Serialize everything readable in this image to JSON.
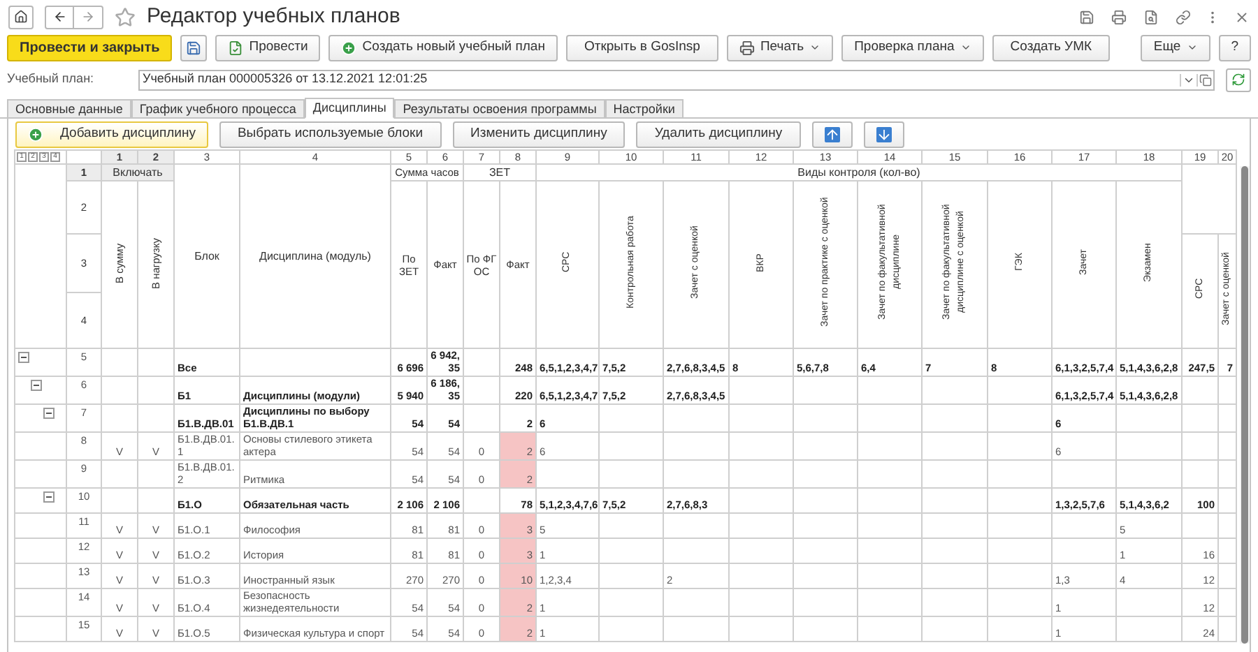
{
  "window": {
    "title": "Редактор учебных планов"
  },
  "toolbar": {
    "buttons": [
      {
        "kind": "primary",
        "label": "Провести и закрыть"
      },
      {
        "kind": "save"
      },
      {
        "kind": "post",
        "label": "Провести"
      },
      {
        "kind": "create",
        "label": "Создать новый учебный план"
      },
      {
        "kind": "plain",
        "label": "Открыть в GosInsp"
      },
      {
        "kind": "print",
        "label": "Печать"
      },
      {
        "kind": "menu",
        "label": "Проверка плана"
      },
      {
        "kind": "plain",
        "label": "Создать УМК"
      }
    ],
    "more": "Еще",
    "help": "?"
  },
  "plan_field": {
    "label": "Учебный план:",
    "value": "Учебный план 000005326 от 13.12.2021 12:01:25"
  },
  "tabs": [
    {
      "label": "Основные данные",
      "selected": false
    },
    {
      "label": "График учебного процесса",
      "selected": false
    },
    {
      "label": "Дисциплины",
      "selected": true
    },
    {
      "label": "Результаты освоения программы",
      "selected": false
    },
    {
      "label": "Настройки",
      "selected": false
    }
  ],
  "actions": [
    {
      "kind": "add",
      "label": "Добавить дисциплину",
      "focused": true
    },
    {
      "kind": "plain",
      "label": "Выбрать используемые блоки",
      "focused": false
    },
    {
      "kind": "plain",
      "label": "Изменить дисциплину",
      "focused": false
    },
    {
      "kind": "plain",
      "label": "Удалить дисциплину",
      "focused": false
    },
    {
      "kind": "up",
      "focused": false
    },
    {
      "kind": "down",
      "focused": false
    }
  ],
  "table": {
    "header": {
      "outline_levels": [
        "1",
        "2",
        "3",
        "4"
      ],
      "column_numbers": [
        "1",
        "2",
        "3",
        "4",
        "5",
        "6",
        "7",
        "8",
        "9",
        "10",
        "11",
        "12",
        "13",
        "14",
        "15",
        "16",
        "17",
        "18",
        "19",
        "20"
      ],
      "row_numbers": [
        "1",
        "2",
        "3",
        "4"
      ],
      "include": "Включать",
      "include_cols": [
        "В сумму",
        "В нагрузку"
      ],
      "block": "Блок",
      "discipline": "Дисциплина (модуль)",
      "hours": "Сумма часов",
      "hours_cols": [
        "По ЗЕТ",
        "Факт"
      ],
      "zet": "ЗЕТ",
      "zet_cols": [
        "По ФГОС",
        "Факт"
      ],
      "control": "Виды контроля (кол-во)",
      "control_cols": [
        "СРС",
        "Контрольная работа",
        "Зачет с оценкой",
        "ВКР",
        "Зачет по практике с оценкой",
        "Зачет по факультативной дисциплине",
        "Зачет по факультативной дисциплине с оценкой",
        "ГЭК",
        "Зачет",
        "Экзамен"
      ],
      "extra_cols": [
        "СРС",
        "Зачет с оценкой"
      ]
    },
    "rows": [
      {
        "number": "5",
        "kind": "group",
        "expanded": true,
        "flagged": false,
        "cells": [
          null,
          null,
          "Все",
          null,
          "6 696",
          "6 942,35",
          null,
          "248",
          "6,5,1,2,3,4,7",
          "7,5,2",
          "2,7,6,8,3,4,5",
          "8",
          "5,6,7,8",
          "6,4",
          "7",
          "8",
          "6,1,3,2,5,7,4",
          "5,1,4,3,6,2,8",
          "247,5",
          "7"
        ],
        "children": [
          {
            "number": "6",
            "kind": "group",
            "expanded": true,
            "flagged": false,
            "cells": [
              null,
              null,
              "Б1",
              "Дисциплины (модули)",
              "5 940",
              "6 186,35",
              null,
              "220",
              "6,5,1,2,3,4,7",
              "7,5,2",
              "2,7,6,8,3,4,5",
              null,
              null,
              null,
              null,
              null,
              "6,1,3,2,5,7,4",
              "5,1,4,3,6,2,8",
              null,
              null
            ],
            "children": [
              {
                "number": "7",
                "kind": "group",
                "expanded": true,
                "flagged": false,
                "cells": [
                  null,
                  null,
                  "Б1.В.ДВ.01",
                  "Дисциплины по выбору Б1.В.ДВ.1",
                  "54",
                  "54",
                  null,
                  "2",
                  "6",
                  null,
                  null,
                  null,
                  null,
                  null,
                  null,
                  null,
                  "6",
                  null,
                  null,
                  null
                ],
                "children": [
                  {
                    "number": "8",
                    "kind": "item",
                    "flagged": true,
                    "cells": [
                      "V",
                      "V",
                      "Б1.В.ДВ.01.1",
                      "Основы стилевого этикета актера",
                      "54",
                      "54",
                      "0",
                      "2",
                      "6",
                      null,
                      null,
                      null,
                      null,
                      null,
                      null,
                      null,
                      "6",
                      null,
                      null,
                      null
                    ]
                  },
                  {
                    "number": "9",
                    "kind": "item",
                    "flagged": true,
                    "cells": [
                      null,
                      null,
                      "Б1.В.ДВ.01.2",
                      "Ритмика",
                      "54",
                      "54",
                      "0",
                      "2",
                      null,
                      null,
                      null,
                      null,
                      null,
                      null,
                      null,
                      null,
                      null,
                      null,
                      null,
                      null
                    ]
                  }
                ]
              },
              {
                "number": "10",
                "kind": "group",
                "expanded": true,
                "flagged": false,
                "cells": [
                  null,
                  null,
                  "Б1.О",
                  "Обязательная часть",
                  "2 106",
                  "2 106",
                  null,
                  "78",
                  "5,1,2,3,4,7,6",
                  "7,5,2",
                  "2,7,6,8,3",
                  null,
                  null,
                  null,
                  null,
                  null,
                  "1,3,2,5,7,6",
                  "5,1,4,3,6,2",
                  "100",
                  null
                ],
                "children": [
                  {
                    "number": "11",
                    "kind": "item",
                    "flagged": true,
                    "cells": [
                      "V",
                      "V",
                      "Б1.О.1",
                      "Философия",
                      "81",
                      "81",
                      "0",
                      "3",
                      "5",
                      null,
                      null,
                      null,
                      null,
                      null,
                      null,
                      null,
                      null,
                      "5",
                      null,
                      null
                    ]
                  },
                  {
                    "number": "12",
                    "kind": "item",
                    "flagged": true,
                    "cells": [
                      "V",
                      "V",
                      "Б1.О.2",
                      "История",
                      "81",
                      "81",
                      "0",
                      "3",
                      "1",
                      null,
                      null,
                      null,
                      null,
                      null,
                      null,
                      null,
                      null,
                      "1",
                      "16",
                      null
                    ]
                  },
                  {
                    "number": "13",
                    "kind": "item",
                    "flagged": true,
                    "cells": [
                      "V",
                      "V",
                      "Б1.О.3",
                      "Иностранный язык",
                      "270",
                      "270",
                      "0",
                      "10",
                      "1,2,3,4",
                      null,
                      "2",
                      null,
                      null,
                      null,
                      null,
                      null,
                      "1,3",
                      "4",
                      "12",
                      null
                    ]
                  },
                  {
                    "number": "14",
                    "kind": "item",
                    "flagged": true,
                    "cells": [
                      "V",
                      "V",
                      "Б1.О.4",
                      "Безопасность жизнедеятельности",
                      "54",
                      "54",
                      "0",
                      "2",
                      "1",
                      null,
                      null,
                      null,
                      null,
                      null,
                      null,
                      null,
                      "1",
                      null,
                      "12",
                      null
                    ]
                  },
                  {
                    "number": "15",
                    "kind": "item",
                    "flagged": true,
                    "cells": [
                      "V",
                      "V",
                      "Б1.О.5",
                      "Физическая культура и спорт",
                      "54",
                      "54",
                      "0",
                      "2",
                      "1",
                      null,
                      null,
                      null,
                      null,
                      null,
                      null,
                      null,
                      "1",
                      null,
                      "24",
                      null
                    ]
                  }
                ]
              }
            ]
          }
        ]
      }
    ]
  }
}
